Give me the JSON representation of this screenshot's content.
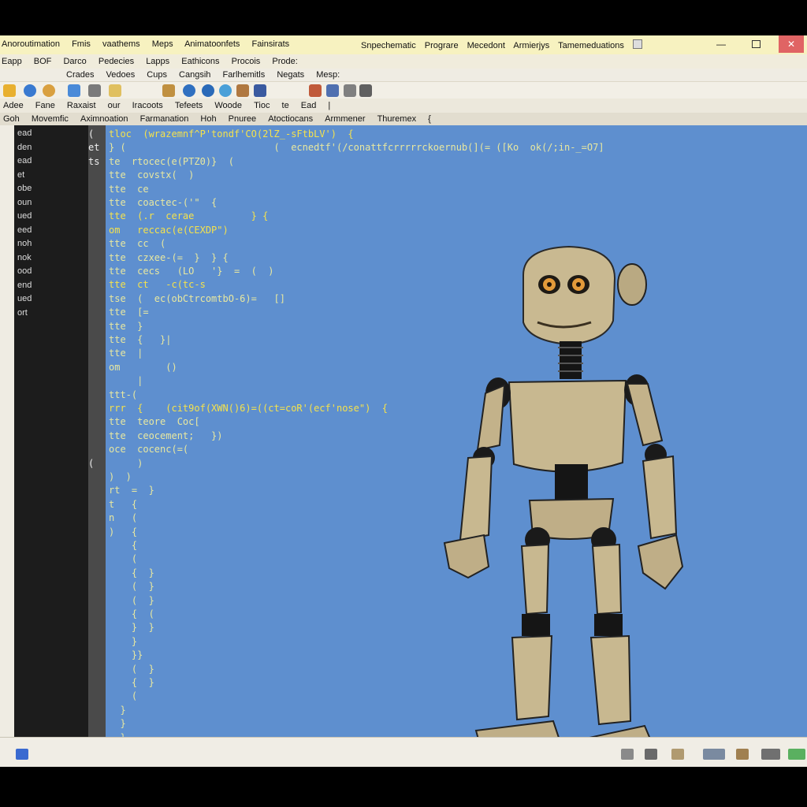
{
  "titlebar": {
    "menu": [
      "Anoroutimation",
      "Fmis",
      "vaathems",
      "Meps",
      "Animatoonfets",
      "Fainsirats"
    ],
    "title": [
      "Snpechematic",
      "Prograre",
      "Mecedont",
      "Armierjys",
      "Tamemeduations"
    ],
    "minimize": "—",
    "close": "✕"
  },
  "menubar": [
    "Eapp",
    "BOF",
    "Darco",
    "Pedecies",
    "Lapps",
    "Eathicons",
    "Procois",
    "Prode:"
  ],
  "submenu": [
    "Crades",
    "Vedoes",
    "Cups",
    "Cangsih",
    "Farlhemitls",
    "Negats",
    "Mesp:"
  ],
  "toolrow": [
    "Adee",
    "Fane",
    "Raxaist",
    "our",
    "Iracoots",
    "Tefeets",
    "Woode",
    "Tioc",
    "te",
    "Ead",
    "|"
  ],
  "tabs": [
    "Goh",
    "Movemfic",
    "Aximnoation",
    "Farmanation",
    "Hoh",
    "Pnuree",
    "Atoctiocans",
    "Armmener",
    "Thuremex",
    "{"
  ],
  "toolbar_icons": [
    "folder-icon",
    "globe-icon",
    "palette-icon",
    "save-icon",
    "settings-icon",
    "image-icon",
    "camera-icon",
    "globe-icon",
    "eye-icon",
    "search-icon",
    "tag-icon",
    "brush-icon"
  ],
  "files": [
    "ead",
    "den",
    "ead",
    "et",
    "obe",
    "oun",
    "ued",
    "eed",
    "noh",
    "nok",
    "ood",
    "end",
    "ued",
    "ort"
  ],
  "code_lines": [
    {
      "num": "(",
      "text": "tloc  (wrazemnf^P'tondf'CO(2lZ_-sFtbLV')  {",
      "hl": true
    },
    {
      "num": "et",
      "text": "} (                          (  ecnedtf'(/conattfcrrrrrckoernub(](= ([Ko  ok(/;in-_=O7]",
      "hl": false
    },
    {
      "num": "ts",
      "text": "te  rtocec(e(PTZ0)}  (",
      "hl": false
    },
    {
      "num": "",
      "text": "tte  covstx(  )",
      "hl": false
    },
    {
      "num": "",
      "text": "tte  ce",
      "hl": false
    },
    {
      "num": "",
      "text": "tte  coactec-('\"  {",
      "hl": false
    },
    {
      "num": "",
      "text": "tte  (.r  cerae          } {",
      "hl": true
    },
    {
      "num": "",
      "text": "om   reccac(e(CEXDP\")",
      "hl": true
    },
    {
      "num": "",
      "text": "tte  cc  (",
      "hl": false
    },
    {
      "num": "",
      "text": "tte  czxee-(=  }  } {",
      "hl": false
    },
    {
      "num": "",
      "text": "tte  cecs   (LO   '}  =  (  )",
      "hl": false
    },
    {
      "num": "",
      "text": "tte  ct   -c(tc-s",
      "hl": true
    },
    {
      "num": "",
      "text": "tse  (  ec(obCtrcomtbO-6)=   []",
      "hl": false
    },
    {
      "num": "",
      "text": "tte  [=",
      "hl": false
    },
    {
      "num": "",
      "text": "tte  }",
      "hl": false
    },
    {
      "num": "",
      "text": "tte  {   }|",
      "hl": false
    },
    {
      "num": "",
      "text": "tte  |",
      "hl": false
    },
    {
      "num": "",
      "text": "om        ()",
      "hl": false
    },
    {
      "num": "",
      "text": "     |",
      "hl": false
    },
    {
      "num": "",
      "text": "ttt-(",
      "hl": false
    },
    {
      "num": "",
      "text": "rrr  {    (cit9of(XWN()6)=((ct=coR'(ecf'nose\")  {",
      "hl": true
    },
    {
      "num": "",
      "text": "tte  teore  Coc[",
      "hl": false
    },
    {
      "num": "",
      "text": "tte  ceocement;   })",
      "hl": false
    },
    {
      "num": "",
      "text": "oce  cocenc(=(",
      "hl": false
    },
    {
      "num": "(",
      "text": "     )",
      "hl": false
    },
    {
      "num": "",
      "text": ")  )",
      "hl": false
    },
    {
      "num": "",
      "text": "rt  =  }",
      "hl": false
    },
    {
      "num": "",
      "text": "t   {",
      "hl": false
    },
    {
      "num": "",
      "text": "n   (",
      "hl": false
    },
    {
      "num": "",
      "text": ")   {",
      "hl": false
    },
    {
      "num": "",
      "text": "    {",
      "hl": false
    },
    {
      "num": "",
      "text": "    (",
      "hl": false
    },
    {
      "num": "",
      "text": "    {  }",
      "hl": false
    },
    {
      "num": "",
      "text": "    (  }",
      "hl": false
    },
    {
      "num": "",
      "text": "    (  }",
      "hl": false
    },
    {
      "num": "",
      "text": "    {  (",
      "hl": false
    },
    {
      "num": "",
      "text": "    }  }",
      "hl": false
    },
    {
      "num": "",
      "text": "    }",
      "hl": false
    },
    {
      "num": "",
      "text": "    }}",
      "hl": false
    },
    {
      "num": "",
      "text": "    (  }",
      "hl": false
    },
    {
      "num": "",
      "text": "    {  }",
      "hl": false
    },
    {
      "num": "",
      "text": "    (",
      "hl": false
    },
    {
      "num": "",
      "text": "  }",
      "hl": false
    },
    {
      "num": "",
      "text": "  }",
      "hl": false
    },
    {
      "num": "",
      "text": "  }",
      "hl": false
    }
  ],
  "status_icons": [
    "window-icon",
    "recycle-icon",
    "trash-icon",
    "document-icon",
    "monitor-icon",
    "archive-icon",
    "network-icon",
    "globe-icon"
  ],
  "colors": {
    "canvas": "#5e8fcf",
    "titlebar": "#f7f2c0",
    "robot_body": "#c8b890",
    "robot_joint": "#1a1a1a"
  }
}
